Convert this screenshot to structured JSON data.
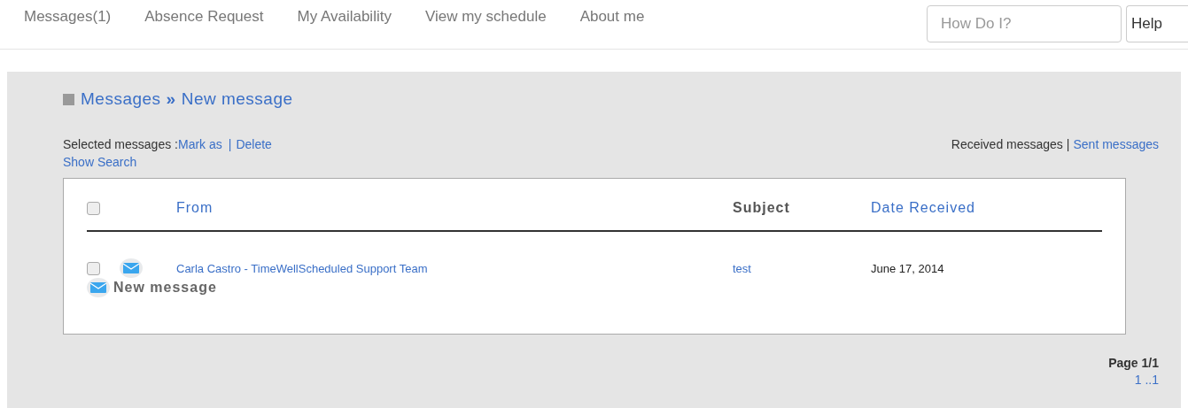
{
  "nav": {
    "items": [
      "Messages(1)",
      "Absence Request",
      "My Availability",
      "View my schedule",
      "About me"
    ],
    "search": {
      "placeholder": "How Do I?"
    },
    "help_button": "Help"
  },
  "breadcrumb": [
    "Messages",
    "»",
    "New message"
  ],
  "actions": {
    "label": "Selected messages :",
    "links": [
      "Mark as",
      "Delete"
    ],
    "separator": "|",
    "show_search": "Show Search"
  },
  "folders": {
    "current": "Received messages",
    "separator": "|",
    "other": "Sent messages"
  },
  "table": {
    "select_all_checked": false,
    "columns": [
      {
        "label": "From",
        "kind": "link"
      },
      {
        "label": "Subject",
        "kind": "plain"
      },
      {
        "label": "Date Received",
        "kind": "link"
      }
    ],
    "rows": [
      {
        "checked": false,
        "from": "Carla Castro - TimeWellScheduled Support Team",
        "subject": "test",
        "date": "June 17, 2014"
      }
    ],
    "new_message": "New message"
  },
  "pagination": {
    "page": "Page 1/1",
    "pages": "1 ..1"
  }
}
